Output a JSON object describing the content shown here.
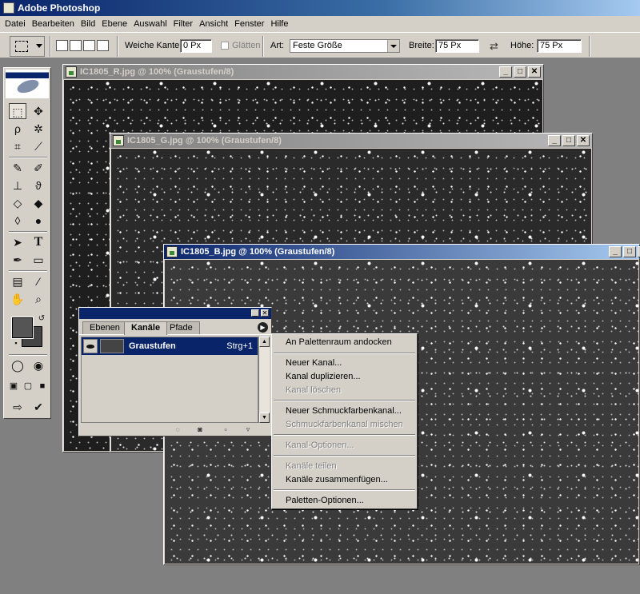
{
  "app": {
    "title": "Adobe Photoshop"
  },
  "menu": [
    "Datei",
    "Bearbeiten",
    "Bild",
    "Ebene",
    "Auswahl",
    "Filter",
    "Ansicht",
    "Fenster",
    "Hilfe"
  ],
  "options": {
    "feather_label": "Weiche Kante:",
    "feather_value": "0 Px",
    "antialias_label": "Glätten",
    "style_label": "Art:",
    "style_value": "Feste Größe",
    "width_label": "Breite:",
    "width_value": "75 Px",
    "height_label": "Höhe:",
    "height_value": "75 Px"
  },
  "documents": [
    {
      "title": "IC1805_R.jpg @ 100% (Graustufen/8)"
    },
    {
      "title": "IC1805_G.jpg @ 100% (Graustufen/8)"
    },
    {
      "title": "IC1805_B.jpg @ 100% (Graustufen/8)"
    }
  ],
  "window_buttons": {
    "minimize": "_",
    "maximize": "□",
    "close": "✕"
  },
  "panel": {
    "tabs": [
      "Ebenen",
      "Kanäle",
      "Pfade"
    ],
    "active_tab": "Kanäle",
    "channel": {
      "name": "Graustufen",
      "shortcut": "Strg+1"
    }
  },
  "context_menu": {
    "items": [
      {
        "label": "An Palettenraum andocken",
        "enabled": true
      },
      {
        "label": "Neuer Kanal...",
        "enabled": true
      },
      {
        "label": "Kanal duplizieren...",
        "enabled": true
      },
      {
        "label": "Kanal löschen",
        "enabled": false
      },
      {
        "label": "Neuer Schmuckfarbenkanal...",
        "enabled": true
      },
      {
        "label": "Schmuckfarbenkanal mischen",
        "enabled": false
      },
      {
        "label": "Kanal-Optionen...",
        "enabled": false
      },
      {
        "label": "Kanäle teilen",
        "enabled": false
      },
      {
        "label": "Kanäle zusammenfügen...",
        "enabled": true
      },
      {
        "label": "Paletten-Optionen...",
        "enabled": true
      }
    ]
  },
  "toolbox": {
    "tools": [
      "rectangular-marquee",
      "move",
      "lasso",
      "magic-wand",
      "crop",
      "slice",
      "healing-brush",
      "brush",
      "clone-stamp",
      "history-brush",
      "eraser",
      "paint-bucket",
      "blur",
      "dodge",
      "path-selection",
      "type",
      "pen",
      "rectangle",
      "notes",
      "eyedropper",
      "hand",
      "zoom"
    ],
    "text_tool_glyph": "T",
    "foreground_color": "#555555",
    "background_color": "#444444"
  },
  "colors": {
    "title_active": "#0a246a",
    "chrome": "#d4d0c8",
    "workspace": "#808080"
  }
}
